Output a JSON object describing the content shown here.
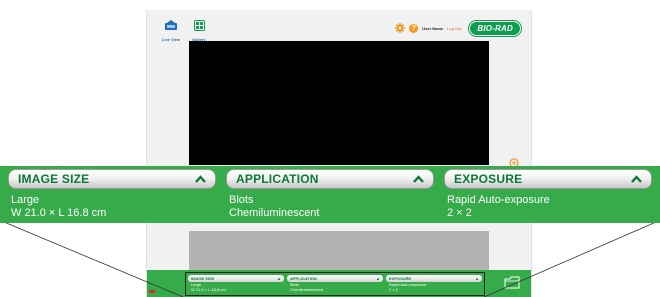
{
  "nav": {
    "live_view": "Live View",
    "gallery": "Gallery"
  },
  "header": {
    "user_name": "User Name",
    "log_out": "Log Out",
    "logo": "BIO-RAD"
  },
  "panels": [
    {
      "title": "IMAGE SIZE",
      "line1": "Large",
      "line2": "W 21.0 × L 16.8 cm"
    },
    {
      "title": "APPLICATION",
      "line1": "Blots",
      "line2": "Chemiluminescent"
    },
    {
      "title": "EXPOSURE",
      "line1": "Rapid Auto-exposure",
      "line2": "2 × 2"
    }
  ],
  "mini_panels": [
    {
      "title": "IMAGE SIZE",
      "line1": "Large",
      "line2": "W 21.0 × L 16.8 cm"
    },
    {
      "title": "APPLICATION",
      "line1": "Blots",
      "line2": "Chemiluminescent"
    },
    {
      "title": "EXPOSURE",
      "line1": "Rapid Auto-exposure",
      "line2": "2 × 2"
    }
  ],
  "colors": {
    "brand_green": "#36ab4a",
    "accent_orange": "#f39a1d",
    "logout_orange": "#e8662a",
    "nav_blue": "#1f6fb7"
  },
  "icons": [
    "live-view-icon",
    "gallery-icon",
    "gear-icon",
    "help-icon",
    "zoom-in-icon",
    "chevron-up-icon",
    "folder-icon"
  ]
}
